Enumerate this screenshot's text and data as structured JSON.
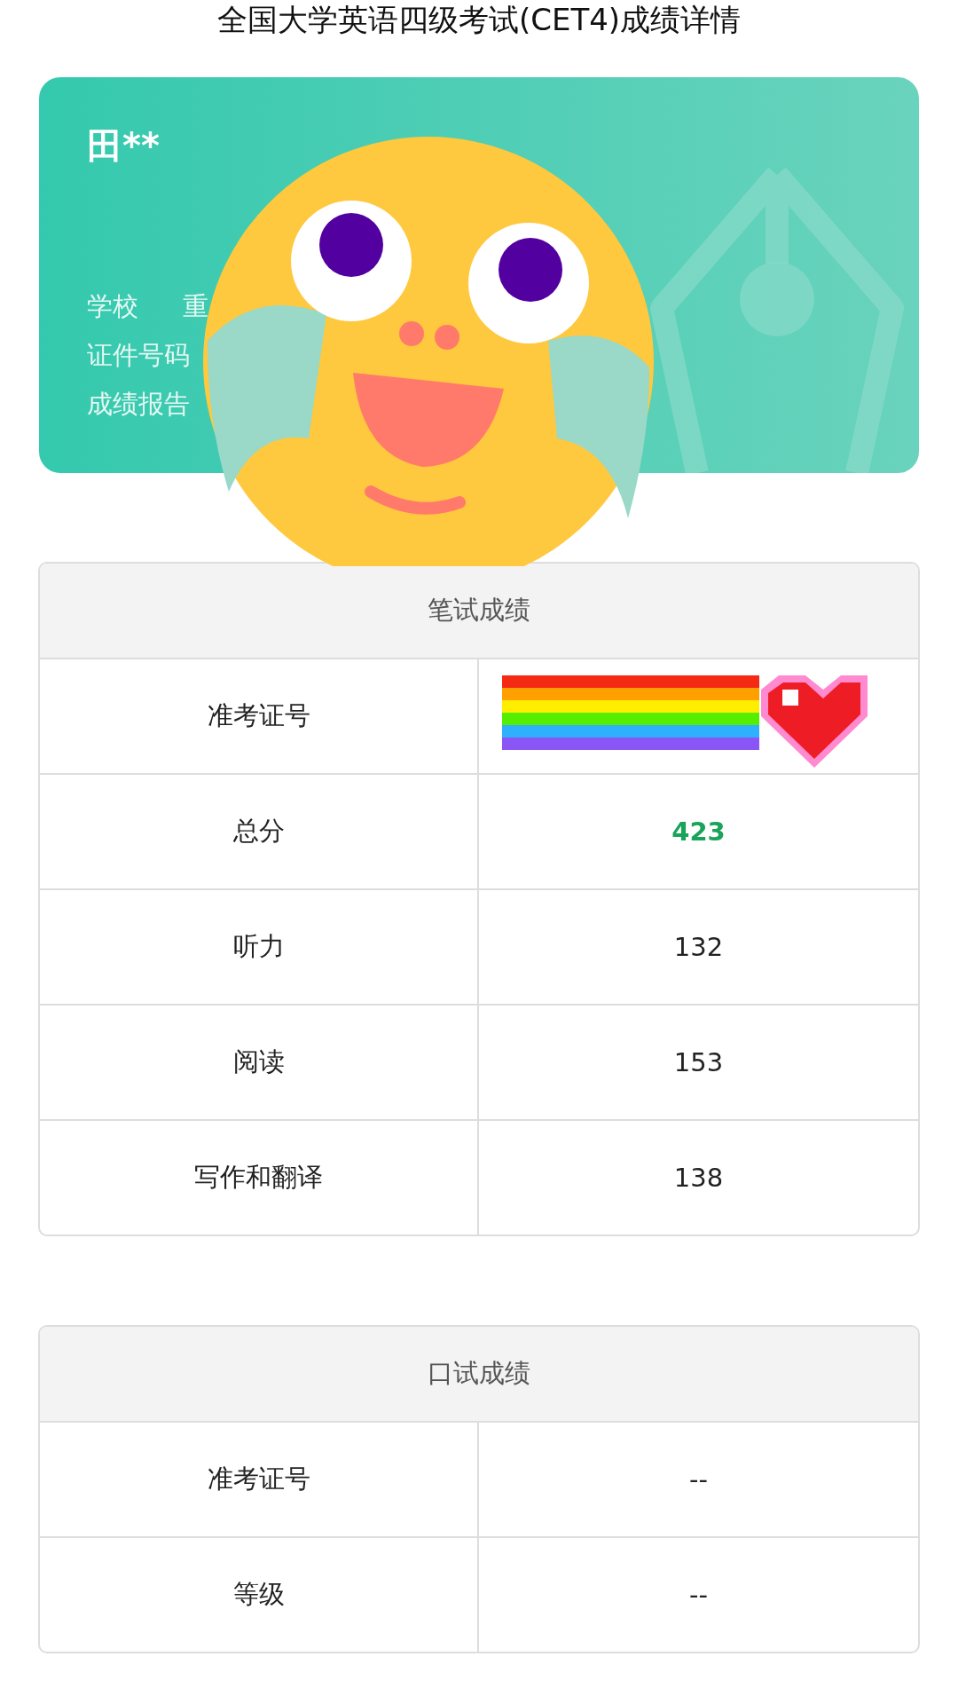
{
  "title": "全国大学英语四级考试(CET4)成绩详情",
  "profile": {
    "name": "田**",
    "fields": [
      {
        "label": "学校",
        "value": "重"
      },
      {
        "label": "证件号码"
      },
      {
        "label": "成绩报告"
      }
    ]
  },
  "sections": [
    {
      "heading": "笔试成绩",
      "rows": [
        {
          "label": "准考证号",
          "kind": "sticker"
        },
        {
          "label": "总分",
          "value": "423",
          "kind": "total"
        },
        {
          "label": "听力",
          "value": "132",
          "kind": "plain"
        },
        {
          "label": "阅读",
          "value": "153",
          "kind": "plain"
        },
        {
          "label": "写作和翻译",
          "value": "138",
          "kind": "plain"
        }
      ]
    },
    {
      "heading": "口试成绩",
      "rows": [
        {
          "label": "准考证号",
          "value": "--",
          "kind": "plain"
        },
        {
          "label": "等级",
          "value": "--",
          "kind": "plain"
        }
      ]
    }
  ]
}
